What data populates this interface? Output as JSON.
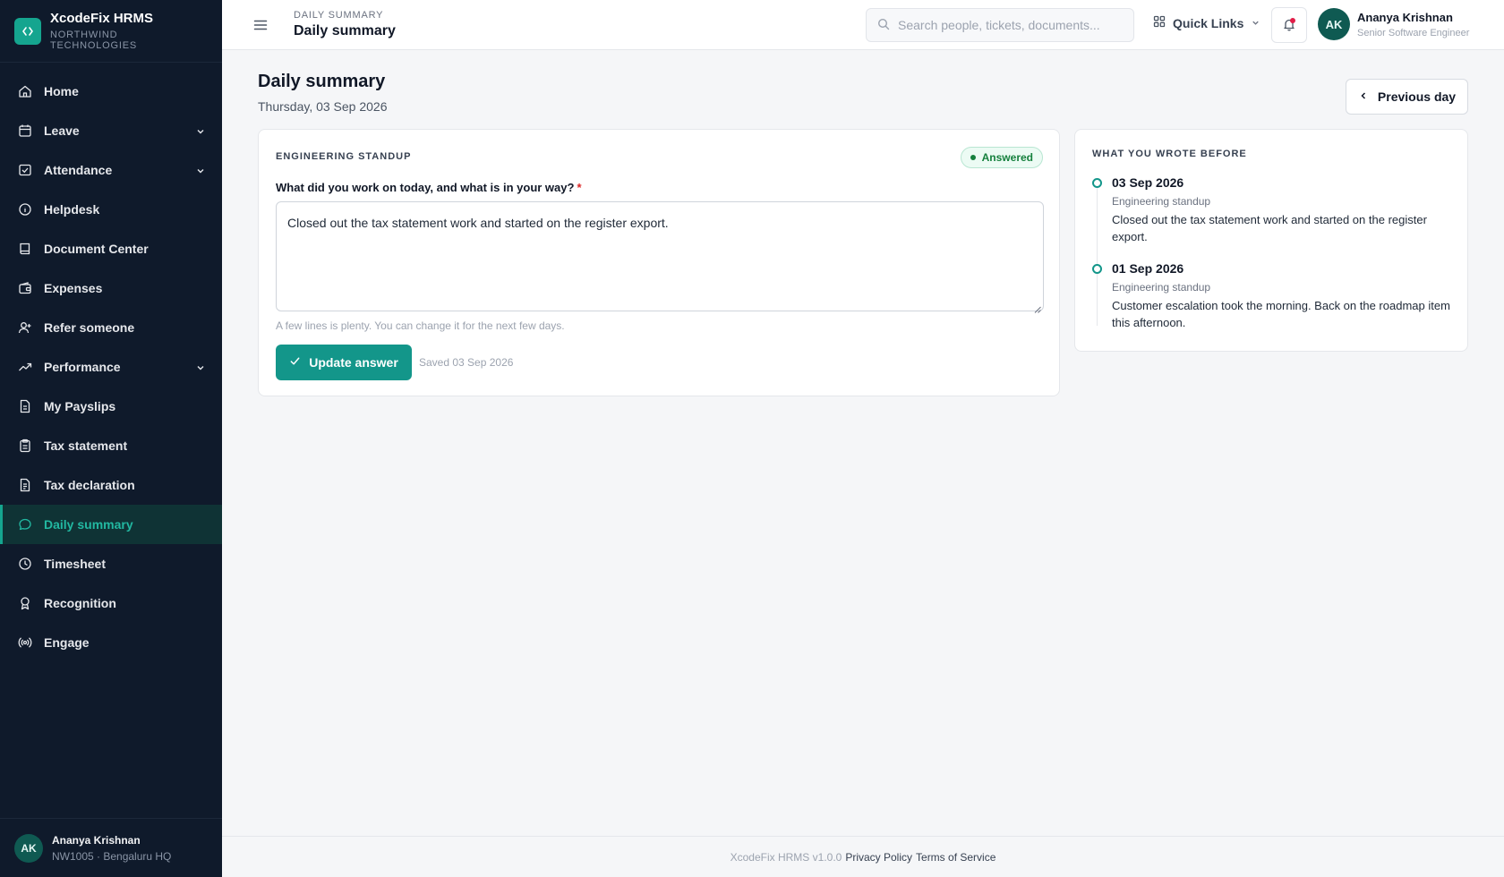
{
  "brand": {
    "name": "XcodeFix HRMS",
    "org": "NORTHWIND TECHNOLOGIES",
    "logo_icon": "code-brackets-icon",
    "accent": "#15a58f"
  },
  "sidebar": {
    "items": [
      {
        "label": "Home",
        "icon": "home-icon"
      },
      {
        "label": "Leave",
        "icon": "calendar-icon",
        "expandable": true
      },
      {
        "label": "Attendance",
        "icon": "checkbox-icon",
        "expandable": true
      },
      {
        "label": "Helpdesk",
        "icon": "info-icon"
      },
      {
        "label": "Document Center",
        "icon": "book-icon"
      },
      {
        "label": "Expenses",
        "icon": "wallet-icon"
      },
      {
        "label": "Refer someone",
        "icon": "user-plus-icon"
      },
      {
        "label": "Performance",
        "icon": "trending-up-icon",
        "expandable": true
      },
      {
        "label": "My Payslips",
        "icon": "file-icon"
      },
      {
        "label": "Tax statement",
        "icon": "clipboard-icon"
      },
      {
        "label": "Tax declaration",
        "icon": "file-text-icon"
      },
      {
        "label": "Daily summary",
        "icon": "chat-icon",
        "active": true
      },
      {
        "label": "Timesheet",
        "icon": "clock-icon"
      },
      {
        "label": "Recognition",
        "icon": "award-icon"
      },
      {
        "label": "Engage",
        "icon": "broadcast-icon"
      }
    ],
    "user": {
      "initials": "AK",
      "name": "Ananya Krishnan",
      "meta": "NW1005 · Bengaluru HQ"
    }
  },
  "topbar": {
    "breadcrumb_small": "DAILY SUMMARY",
    "breadcrumb_title": "Daily summary",
    "search_placeholder": "Search people, tickets, documents...",
    "quick_links_label": "Quick Links",
    "user": {
      "initials": "AK",
      "name": "Ananya Krishnan",
      "role": "Senior Software Engineer"
    }
  },
  "page": {
    "title": "Daily summary",
    "date": "Thursday, 03 Sep 2026",
    "previous_day_label": "Previous day"
  },
  "standup": {
    "section_label": "ENGINEERING STANDUP",
    "status_badge": "Answered",
    "question": "What did you work on today, and what is in your way?",
    "required_marker": "*",
    "answer": "Closed out the tax statement work and started on the register export.",
    "hint": "A few lines is plenty. You can change it for the next few days.",
    "update_label": "Update answer",
    "saved_text": "Saved 03 Sep 2026"
  },
  "history": {
    "section_label": "WHAT YOU WROTE BEFORE",
    "entries": [
      {
        "date": "03 Sep 2026",
        "type": "Engineering standup",
        "text": "Closed out the tax statement work and started on the register export."
      },
      {
        "date": "01 Sep 2026",
        "type": "Engineering standup",
        "text": "Customer escalation took the morning. Back on the roadmap item this afternoon."
      }
    ]
  },
  "footer": {
    "version": "XcodeFix HRMS v1.0.0",
    "privacy": "Privacy Policy",
    "terms": "Terms of Service"
  }
}
